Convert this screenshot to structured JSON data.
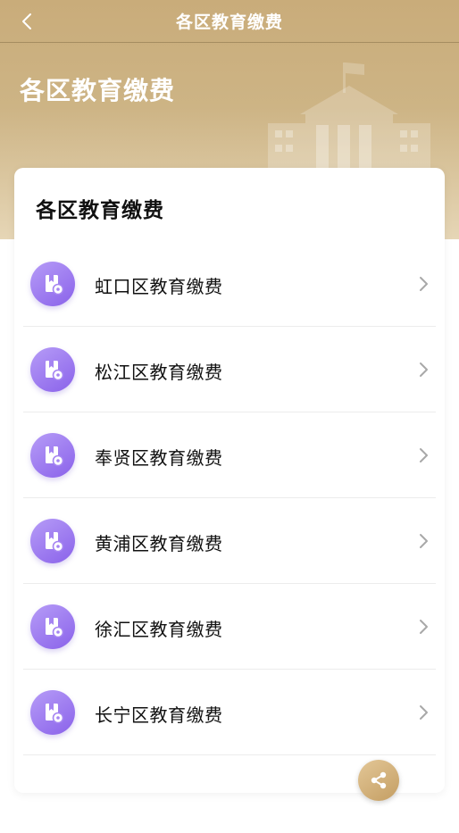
{
  "navbar": {
    "title": "各区教育缴费",
    "back_icon": "chevron-left-icon"
  },
  "hero": {
    "title": "各区教育缴费",
    "illustration": "school-building-icon"
  },
  "card": {
    "title": "各区教育缴费",
    "items": [
      {
        "label": "虹口区教育缴费",
        "icon": "payment-book-icon"
      },
      {
        "label": "松江区教育缴费",
        "icon": "payment-book-icon"
      },
      {
        "label": "奉贤区教育缴费",
        "icon": "payment-book-icon"
      },
      {
        "label": "黄浦区教育缴费",
        "icon": "payment-book-icon"
      },
      {
        "label": "徐汇区教育缴费",
        "icon": "payment-book-icon"
      },
      {
        "label": "长宁区教育缴费",
        "icon": "payment-book-icon"
      }
    ]
  },
  "share": {
    "icon": "share-icon"
  },
  "colors": {
    "header_gold": "#c9ac7a",
    "icon_purple": "#8a62ea",
    "share_gold": "#c49e63"
  }
}
